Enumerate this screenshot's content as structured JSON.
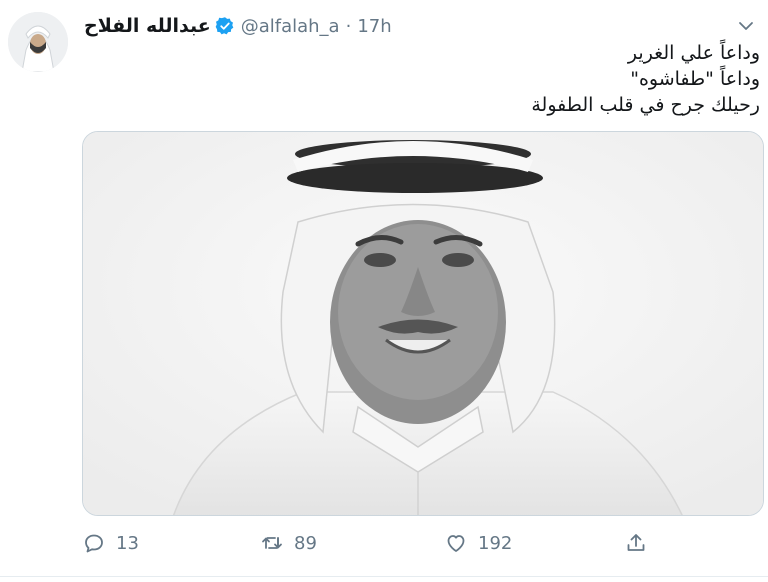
{
  "author": {
    "display_name": "عبدالله الفلاح",
    "handle": "@alfalah_a",
    "separator": "·",
    "time": "17h"
  },
  "tweet": {
    "lines": [
      "وداعاً علي الغرير",
      "وداعاً \"طفاشوه\"",
      "رحيلك جرح في قلب الطفولة"
    ]
  },
  "actions": {
    "replies": "13",
    "retweets": "89",
    "likes": "192"
  },
  "icons": {
    "verified": "verified-badge-icon",
    "menu": "chevron-down-icon",
    "reply": "reply-icon",
    "retweet": "retweet-icon",
    "like": "heart-icon",
    "share": "share-icon"
  },
  "colors": {
    "text": "#14171a",
    "secondary": "#657786",
    "verified": "#1da1f2",
    "border": "#ccd6dd"
  }
}
